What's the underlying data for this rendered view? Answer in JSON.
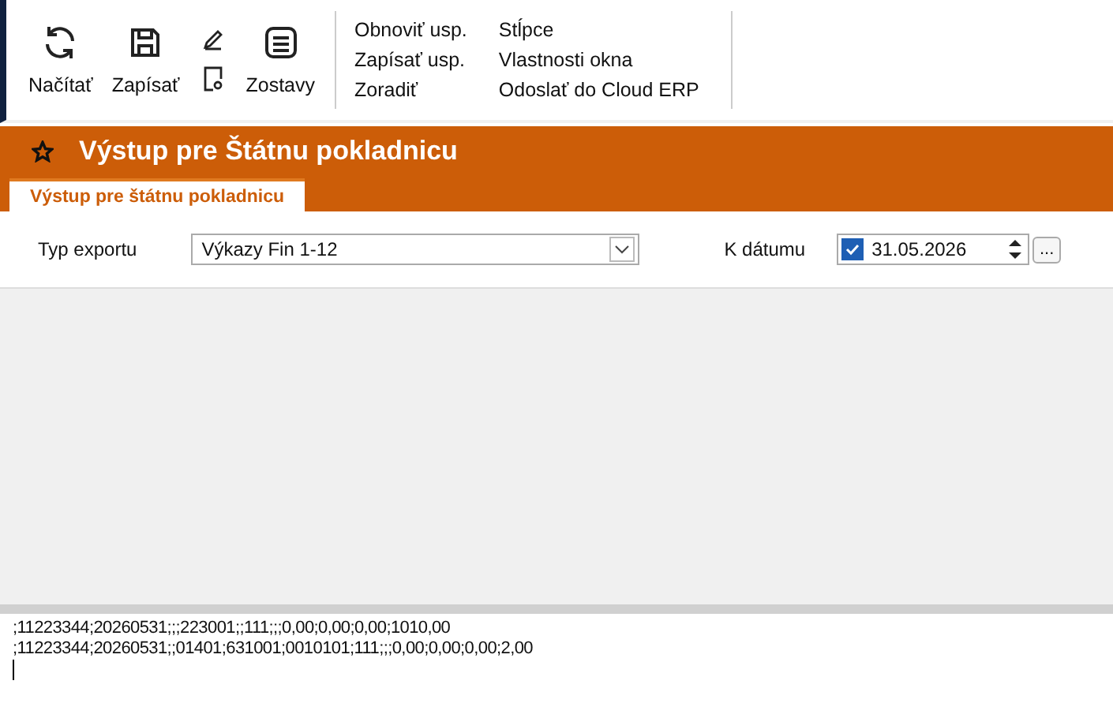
{
  "toolbar": {
    "big_buttons": [
      {
        "label": "Načítať"
      },
      {
        "label": "Zapísať"
      }
    ],
    "report_button": {
      "label": "Zostavy"
    },
    "menu_columns": [
      [
        "Obnoviť usp.",
        "Zapísať usp.",
        "Zoradiť"
      ],
      [
        "Stĺpce",
        "Vlastnosti okna",
        "Odoslať do Cloud ERP"
      ]
    ]
  },
  "header": {
    "title": "Výstup pre Štátnu pokladnicu"
  },
  "tabs": [
    {
      "label": "Výstup pre štátnu pokladnicu",
      "selected": true
    }
  ],
  "form": {
    "export_type": {
      "label": "Typ exportu",
      "value": "Výkazy Fin 1-12"
    },
    "date": {
      "label": "K dátumu",
      "checked": true,
      "value": "31.05.2026",
      "browse": "..."
    }
  },
  "output_lines": [
    ";11223344;20260531;;;223001;;111;;;0,00;0,00;0,00;1010,00",
    ";11223344;20260531;;01401;631001;0010101;111;;;0,00;0,00;0,00;2,00"
  ]
}
